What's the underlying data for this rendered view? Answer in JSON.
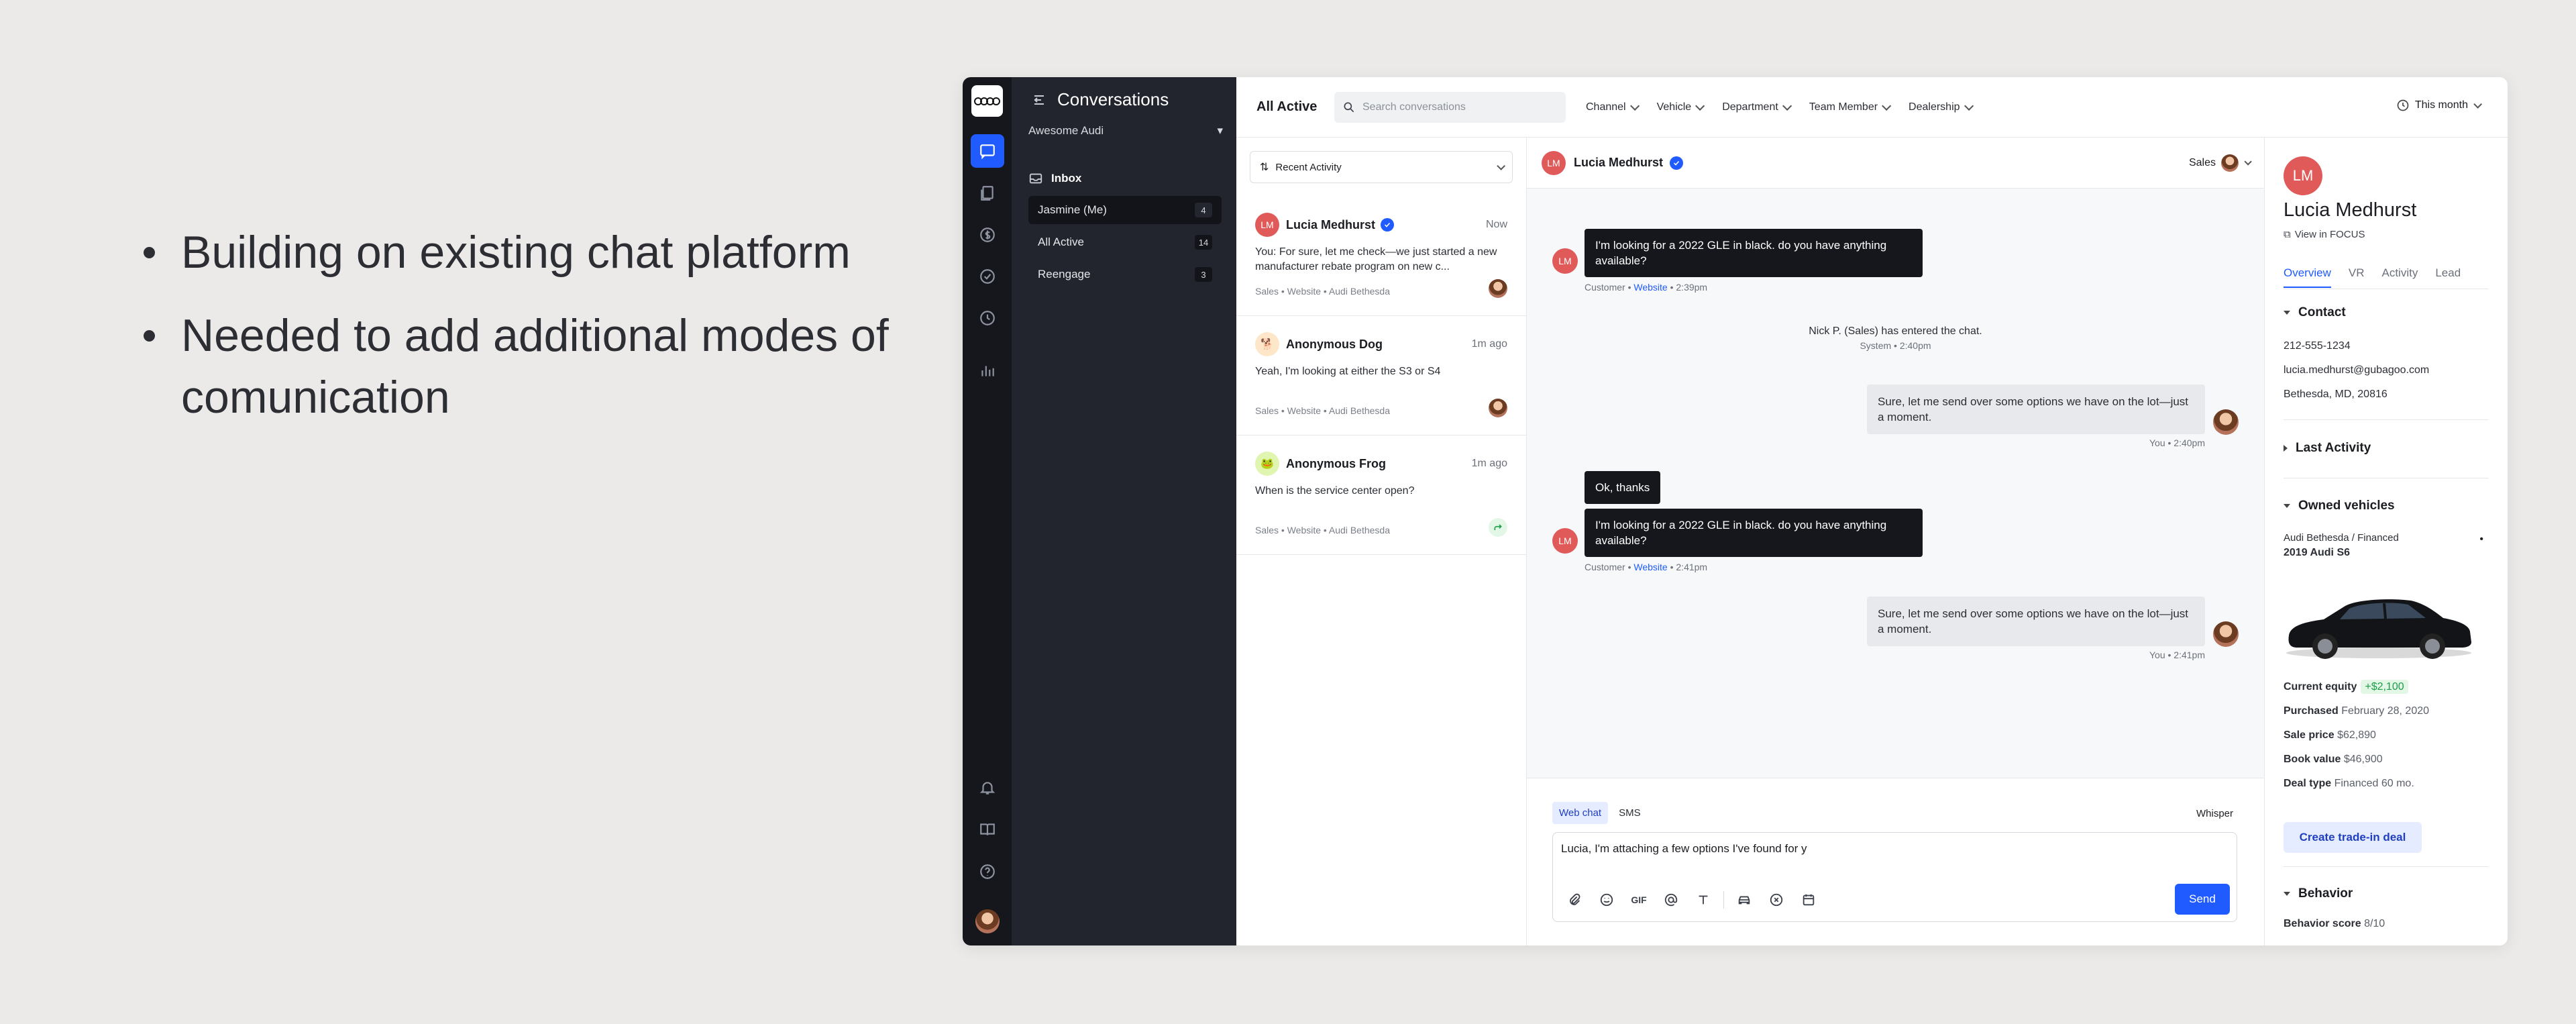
{
  "slide": {
    "bullets": [
      "Building on existing chat platform",
      "Needed to add additional modes of comunication"
    ]
  },
  "sidebar": {
    "title": "Conversations",
    "dealership": "Awesome Audi",
    "inbox_label": "Inbox",
    "items": [
      {
        "label": "Jasmine (Me)",
        "count": "4"
      },
      {
        "label": "All Active",
        "count": "14"
      },
      {
        "label": "Reengage",
        "count": "3"
      }
    ]
  },
  "toolbar": {
    "title": "All Active",
    "search_placeholder": "Search conversations",
    "filters": [
      "Channel",
      "Vehicle",
      "Department",
      "Team Member",
      "Dealership"
    ],
    "period": "This month"
  },
  "conversation_list": {
    "sort_label": "Recent Activity",
    "items": [
      {
        "initials": "LM",
        "name": "Lucia Medhurst",
        "time": "Now",
        "preview": "You: For sure, let me check—we just started a new manufacturer rebate program on new c...",
        "meta": "Sales • Website • Audi Bethesda"
      },
      {
        "initials": "🐕",
        "name": "Anonymous Dog",
        "time": "1m ago",
        "preview": "Yeah, I'm looking at either the S3 or S4",
        "meta": "Sales • Website • Audi Bethesda"
      },
      {
        "initials": "🐸",
        "name": "Anonymous Frog",
        "time": "1m ago",
        "preview": "When is the service center open?",
        "meta": "Sales • Website • Audi Bethesda"
      }
    ]
  },
  "chat": {
    "contact_initials": "LM",
    "contact_name": "Lucia Medhurst",
    "department": "Sales",
    "messages": {
      "m1": {
        "text": "I'm looking for a 2022 GLE in black. do you have anything available?",
        "sender": "Customer",
        "channel": "Website",
        "time": "2:39pm"
      },
      "system": {
        "text": "Nick P. (Sales) has entered the chat.",
        "sub": "System • 2:40pm"
      },
      "m2": {
        "text": "Sure, let me send over some options we have on the lot—just a moment.",
        "meta": "You • 2:40pm"
      },
      "m3a": {
        "text": "Ok, thanks"
      },
      "m3b": {
        "text": "I'm looking for a 2022 GLE in black. do you have anything available?",
        "sender": "Customer",
        "channel": "Website",
        "time": "2:41pm"
      },
      "m4": {
        "text": "Sure, let me send over some options we have on the lot—just a moment.",
        "meta": "You • 2:41pm"
      }
    },
    "composer": {
      "tabs": [
        "Web chat",
        "SMS"
      ],
      "whisper": "Whisper",
      "draft": "Lucia, I'm attaching a few options I've found for y",
      "gif_label": "GIF",
      "send_label": "Send"
    }
  },
  "details": {
    "initials": "LM",
    "name": "Lucia Medhurst",
    "focus_link": "View in FOCUS",
    "tabs": [
      "Overview",
      "VR",
      "Activity",
      "Lead"
    ],
    "contact": {
      "title": "Contact",
      "phone": "212-555-1234",
      "email": "lucia.medhurst@gubagoo.com",
      "location": "Bethesda, MD, 20816"
    },
    "last_activity": "Last Activity",
    "owned": {
      "title": "Owned vehicles",
      "dealer": "Audi Bethesda / Financed",
      "vehicle": "2019 Audi S6",
      "equity_label": "Current equity",
      "equity_value": "+$2,100",
      "purchased_label": "Purchased",
      "purchased_value": "February 28, 2020",
      "price_label": "Sale price",
      "price_value": "$62,890",
      "book_label": "Book value",
      "book_value": "$46,900",
      "deal_label": "Deal type",
      "deal_value": "Financed 60 mo.",
      "trade_button": "Create trade-in deal"
    },
    "behavior": {
      "title": "Behavior",
      "score_label": "Behavior score",
      "score_value": "8/10"
    }
  }
}
